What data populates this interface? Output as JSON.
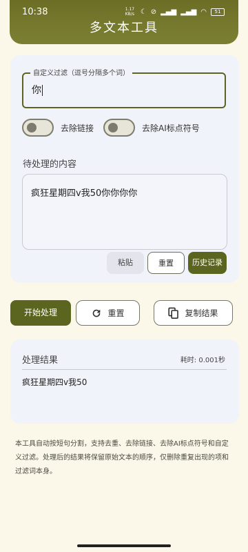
{
  "status": {
    "time": "10:38",
    "speed": "1.17 KB/s",
    "battery": "51"
  },
  "header": {
    "title": "多文本工具"
  },
  "filter": {
    "label": "自定义过滤（逗号分隔多个词）",
    "value": "你"
  },
  "toggles": [
    {
      "label": "去除链接",
      "checked": false
    },
    {
      "label": "去除AI标点符号",
      "checked": false
    }
  ],
  "input": {
    "label": "待处理的内容",
    "value": "疯狂星期四v我50你你你你"
  },
  "input_buttons": {
    "paste": "粘贴",
    "reset": "重置",
    "history": "历史记录"
  },
  "actions": {
    "start": "开始处理",
    "reset": "重置",
    "copy": "复制结果"
  },
  "result": {
    "title": "处理结果",
    "elapsed": "耗时: 0.001秒",
    "text": "疯狂星期四v我50"
  },
  "description": "本工具自动按短句分割，支持去重、去除链接、去除AI标点符号和自定义过滤。处理后的结果将保留原始文本的顺序，仅删除重复出现的项和过滤词本身。",
  "colors": {
    "accent": "#5c6520",
    "background": "#FBF8EA",
    "card": "#F1F3FA"
  }
}
